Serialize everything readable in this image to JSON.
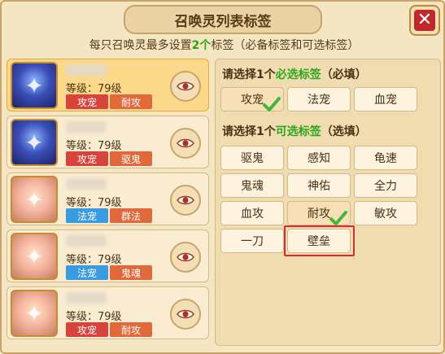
{
  "window": {
    "title": "召唤灵列表标签",
    "close_label": "✕"
  },
  "hint": {
    "prefix": "每只召唤灵最多设置",
    "count": "2个",
    "suffix": "标签（必备标签和可选标签）"
  },
  "pets": [
    {
      "level": "等级：79级",
      "tags": [
        "攻宠",
        "耐攻"
      ],
      "tag_colors": [
        "red",
        "orange"
      ],
      "avatar": "blue",
      "selected": true
    },
    {
      "level": "等级：79级",
      "tags": [
        "攻宠",
        "驱鬼"
      ],
      "tag_colors": [
        "red",
        "orange"
      ],
      "avatar": "blue",
      "selected": false
    },
    {
      "level": "等级：79级",
      "tags": [
        "法宠",
        "群法"
      ],
      "tag_colors": [
        "blue",
        "orange"
      ],
      "avatar": "pink",
      "selected": false
    },
    {
      "level": "等级：79级",
      "tags": [
        "法宠",
        "鬼魂"
      ],
      "tag_colors": [
        "blue",
        "orange"
      ],
      "avatar": "pink",
      "selected": false
    },
    {
      "level": "等级：79级",
      "tags": [
        "攻宠",
        "耐攻"
      ],
      "tag_colors": [
        "red",
        "orange"
      ],
      "avatar": "pink",
      "selected": false
    }
  ],
  "required": {
    "title_prefix": "请选择1个",
    "title_green": "必选标签",
    "title_suffix": "（必填）",
    "options": [
      "攻宠",
      "法宠",
      "血宠"
    ],
    "checked": "攻宠"
  },
  "optional": {
    "title_prefix": "请选择1个",
    "title_green": "可选标签",
    "title_suffix": "（选填）",
    "options": [
      "驱鬼",
      "感知",
      "龟速",
      "鬼魂",
      "神佑",
      "全力",
      "血攻",
      "耐攻",
      "敏攻",
      "一刀",
      "壁垒"
    ],
    "checked": "耐攻",
    "highlighted": "壁垒"
  },
  "colors": {
    "accent_green": "#2ca71a",
    "highlight_red": "#e0272d",
    "close_red": "#c0282c"
  },
  "icons": {
    "view": "eye-icon",
    "close": "close-icon",
    "check": "check-icon"
  }
}
